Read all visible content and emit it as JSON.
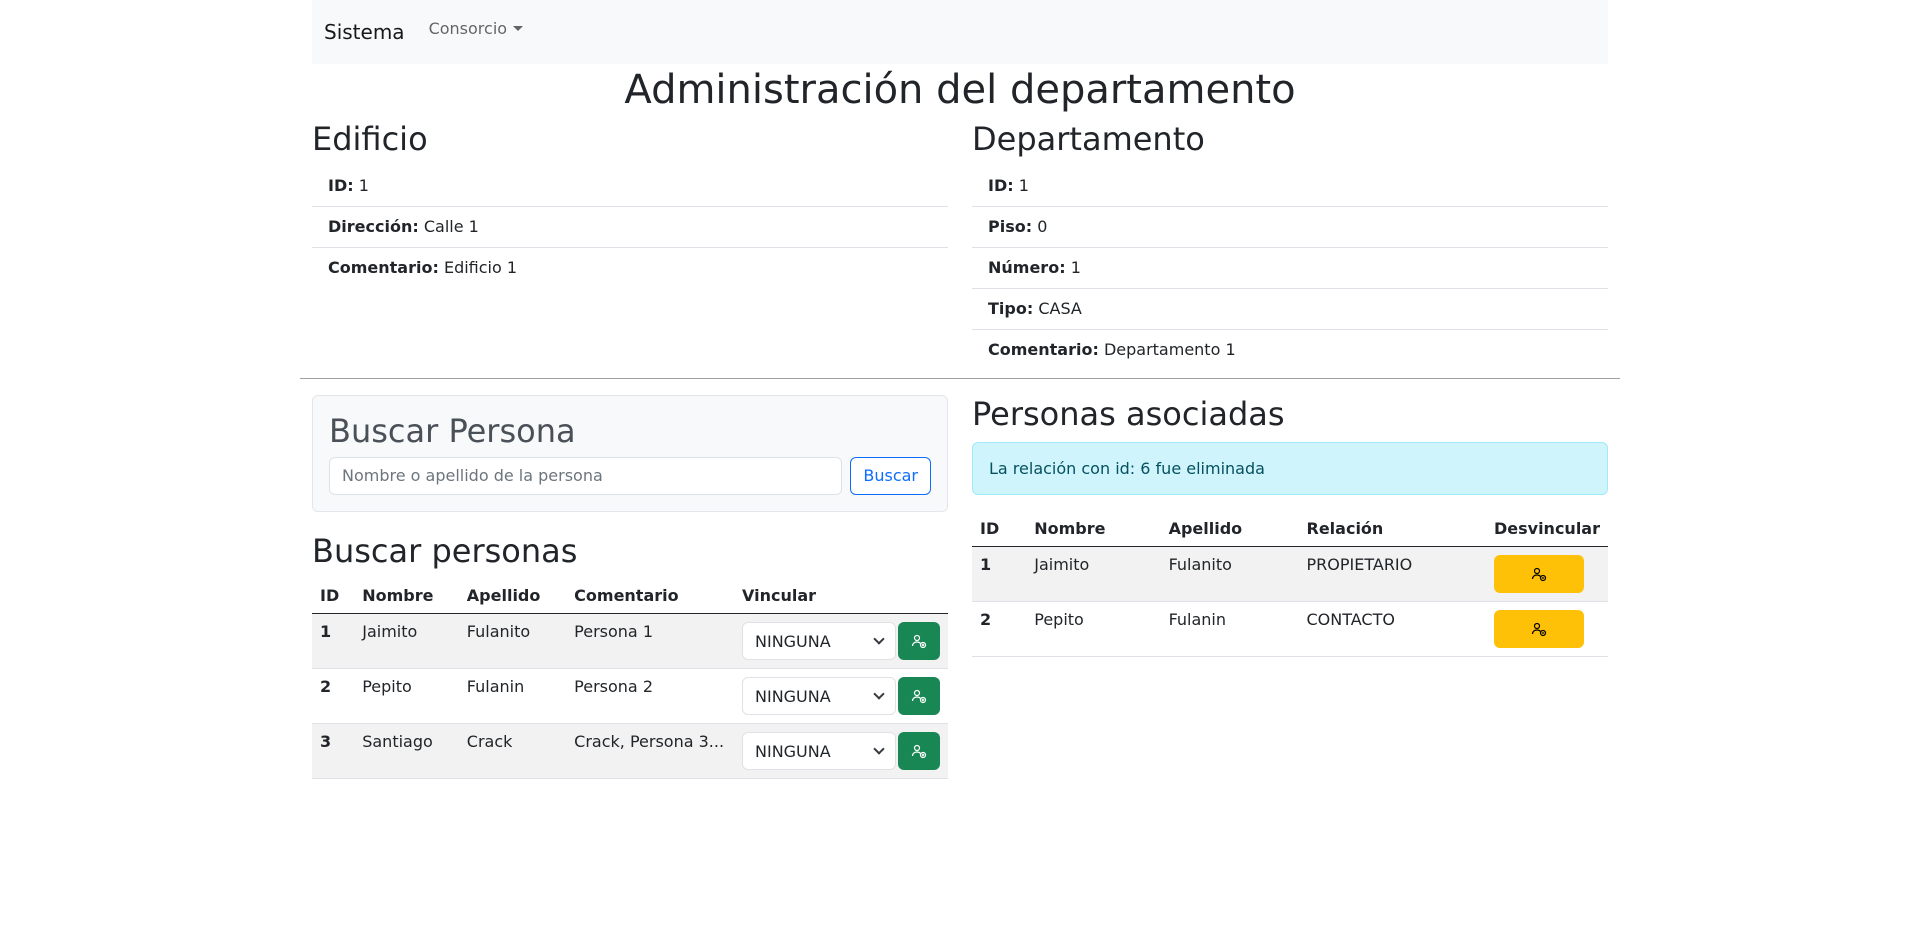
{
  "navbar": {
    "brand": "Sistema",
    "dropdown": "Consorcio"
  },
  "page_title": "Administración del departamento",
  "edificio": {
    "title": "Edificio",
    "fields": [
      {
        "label": "ID:",
        "value": "1"
      },
      {
        "label": "Dirección:",
        "value": "Calle 1"
      },
      {
        "label": "Comentario:",
        "value": "Edificio 1"
      }
    ]
  },
  "departamento": {
    "title": "Departamento",
    "fields": [
      {
        "label": "ID:",
        "value": "1"
      },
      {
        "label": "Piso:",
        "value": "0"
      },
      {
        "label": "Número:",
        "value": "1"
      },
      {
        "label": "Tipo:",
        "value": "CASA"
      },
      {
        "label": "Comentario:",
        "value": "Departamento 1"
      }
    ]
  },
  "buscar_card": {
    "title": "Buscar Persona",
    "placeholder": "Nombre o apellido de la persona",
    "button": "Buscar"
  },
  "buscar_personas": {
    "title": "Buscar personas",
    "headers": {
      "id": "ID",
      "nombre": "Nombre",
      "apellido": "Apellido",
      "comentario": "Comentario",
      "vincular": "Vincular"
    },
    "rows": [
      {
        "id": "1",
        "nombre": "Jaimito",
        "apellido": "Fulanito",
        "comentario": "Persona 1",
        "select": "NINGUNA"
      },
      {
        "id": "2",
        "nombre": "Pepito",
        "apellido": "Fulanin",
        "comentario": "Persona 2",
        "select": "NINGUNA"
      },
      {
        "id": "3",
        "nombre": "Santiago",
        "apellido": "Crack",
        "comentario": "Crack, Persona 3...",
        "select": "NINGUNA"
      }
    ],
    "button_color": "#198754"
  },
  "personas_asociadas": {
    "title": "Personas asociadas",
    "alert": "La relación con id: 6 fue eliminada",
    "headers": {
      "id": "ID",
      "nombre": "Nombre",
      "apellido": "Apellido",
      "relacion": "Relación",
      "desvincular": "Desvincular"
    },
    "rows": [
      {
        "id": "1",
        "nombre": "Jaimito",
        "apellido": "Fulanito",
        "relacion": "PROPIETARIO"
      },
      {
        "id": "2",
        "nombre": "Pepito",
        "apellido": "Fulanin",
        "relacion": "CONTACTO"
      }
    ],
    "button_color": "#ffc107"
  }
}
